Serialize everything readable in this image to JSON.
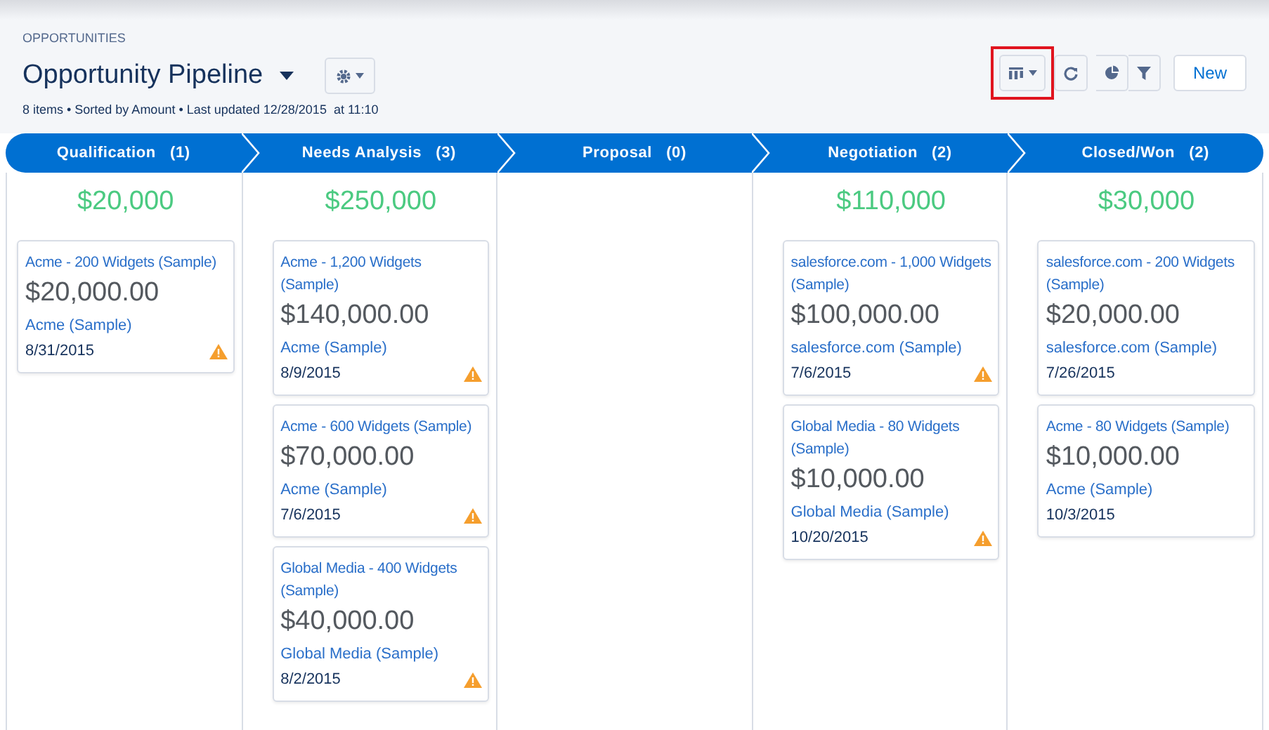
{
  "header": {
    "object_label": "OPPORTUNITIES",
    "title": "Opportunity Pipeline",
    "subtitle": "8 items • Sorted by Amount • Last updated 12/28/2015  at 11:10"
  },
  "toolbar": [
    {
      "kind": "kanban",
      "highlighted": true
    },
    {
      "kind": "refresh",
      "highlighted": false
    },
    {
      "kind": "chart",
      "highlighted": false
    },
    {
      "kind": "filter",
      "highlighted": false
    },
    {
      "kind": "new",
      "label": "New",
      "highlighted": false
    }
  ],
  "stages": [
    {
      "name": "Qualification",
      "count": "(1)",
      "total": "$20,000",
      "cards": [
        {
          "title": "Acme - 200 Widgets (Sample)",
          "amount": "$20,000.00",
          "account": "Acme (Sample)",
          "date": "8/31/2015",
          "warning": true
        }
      ]
    },
    {
      "name": "Needs Analysis",
      "count": "(3)",
      "total": "$250,000",
      "cards": [
        {
          "title": "Acme - 1,200 Widgets (Sample)",
          "amount": "$140,000.00",
          "account": "Acme (Sample)",
          "date": "8/9/2015",
          "warning": true
        },
        {
          "title": "Acme - 600 Widgets (Sample)",
          "amount": "$70,000.00",
          "account": "Acme (Sample)",
          "date": "7/6/2015",
          "warning": true
        },
        {
          "title": "Global Media - 400 Widgets (Sample)",
          "amount": "$40,000.00",
          "account": "Global Media (Sample)",
          "date": "8/2/2015",
          "warning": true
        }
      ]
    },
    {
      "name": "Proposal",
      "count": "(0)"
    },
    {
      "name": "Negotiation",
      "count": "(2)",
      "total": "$110,000",
      "cards": [
        {
          "title": "salesforce.com - 1,000 Widgets (Sample)",
          "amount": "$100,000.00",
          "account": "salesforce.com (Sample)",
          "date": "7/6/2015",
          "warning": true
        },
        {
          "title": "Global Media - 80 Widgets (Sample)",
          "amount": "$10,000.00",
          "account": "Global Media (Sample)",
          "date": "10/20/2015",
          "warning": true
        }
      ]
    },
    {
      "name": "Closed/Won",
      "count": "(2)",
      "total": "$30,000",
      "cards": [
        {
          "title": "salesforce.com - 200 Widgets (Sample)",
          "amount": "$20,000.00",
          "account": "salesforce.com (Sample)",
          "date": "7/26/2015",
          "warning": false
        },
        {
          "title": "Acme - 80 Widgets (Sample)",
          "amount": "$10,000.00",
          "account": "Acme (Sample)",
          "date": "10/3/2015",
          "warning": false
        }
      ]
    }
  ]
}
